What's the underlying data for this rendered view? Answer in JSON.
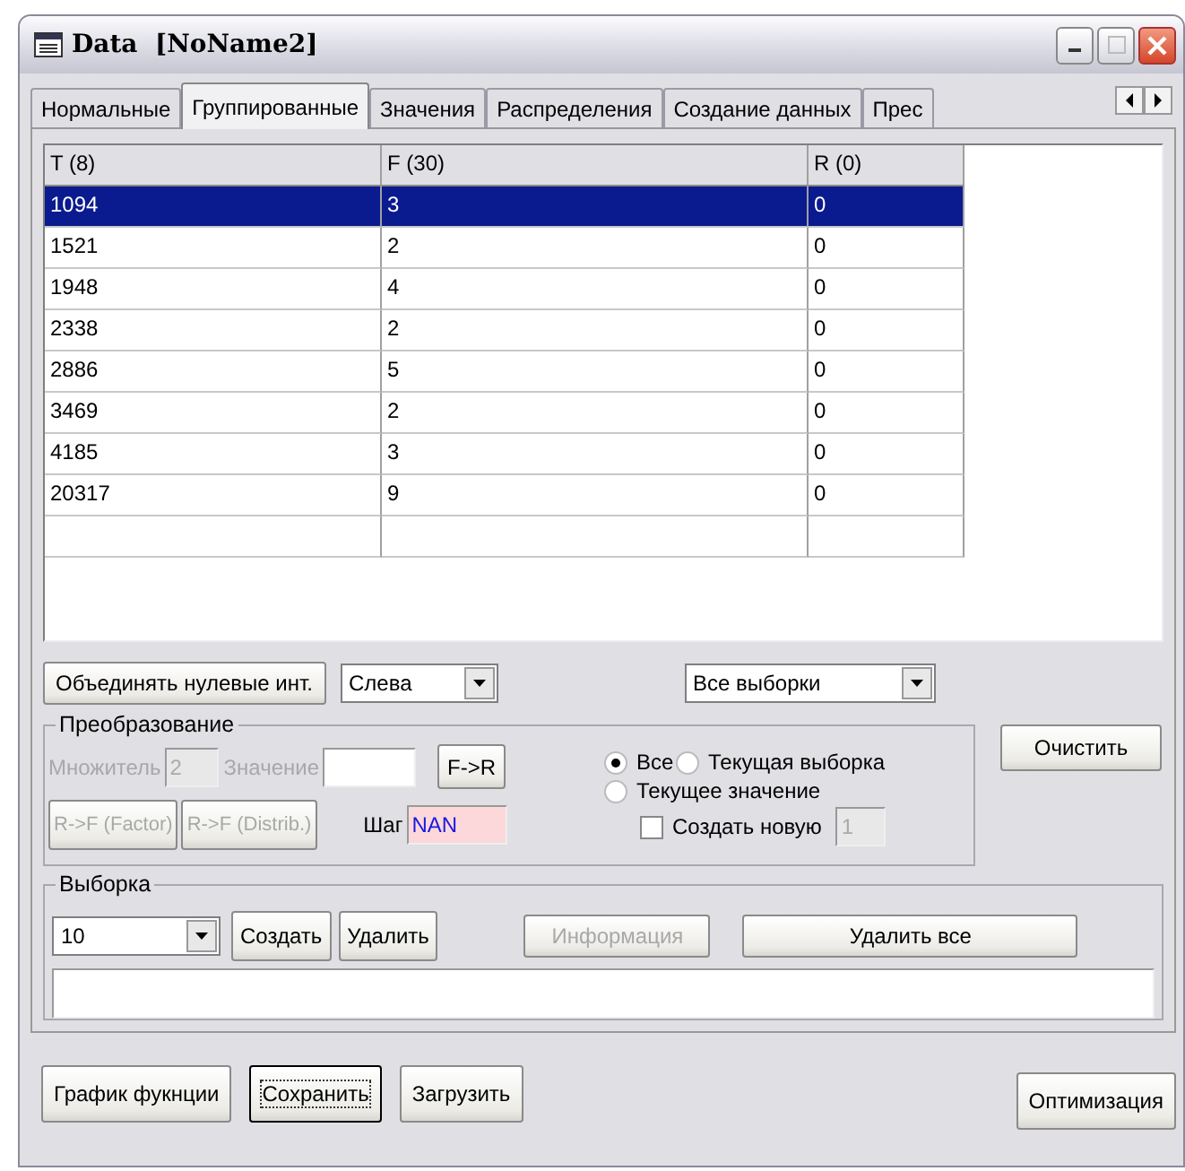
{
  "window": {
    "title": "Data  [NoName2]"
  },
  "tabs": [
    {
      "label": "Нормальные",
      "selected": false
    },
    {
      "label": "Группированные",
      "selected": true
    },
    {
      "label": "Значения",
      "selected": false
    },
    {
      "label": "Распределения",
      "selected": false
    },
    {
      "label": "Создание данных",
      "selected": false
    },
    {
      "label": "Прес",
      "selected": false
    }
  ],
  "table": {
    "columns": [
      "T (8)",
      "F (30)",
      "R (0)"
    ],
    "rows": [
      {
        "cells": [
          "1094",
          "3",
          "0"
        ],
        "selected": true
      },
      {
        "cells": [
          "1521",
          "2",
          "0"
        ],
        "selected": false
      },
      {
        "cells": [
          "1948",
          "4",
          "0"
        ],
        "selected": false
      },
      {
        "cells": [
          "2338",
          "2",
          "0"
        ],
        "selected": false
      },
      {
        "cells": [
          "2886",
          "5",
          "0"
        ],
        "selected": false
      },
      {
        "cells": [
          "3469",
          "2",
          "0"
        ],
        "selected": false
      },
      {
        "cells": [
          "4185",
          "3",
          "0"
        ],
        "selected": false
      },
      {
        "cells": [
          "20317",
          "9",
          "0"
        ],
        "selected": false
      }
    ]
  },
  "merge_button": "Объединять нулевые инт.",
  "side_select": {
    "value": "Слева"
  },
  "samples_select": {
    "value": "Все выборки"
  },
  "transform": {
    "title": "Преобразование",
    "multiplier": {
      "label": "Множитель",
      "value": "2",
      "disabled": true
    },
    "value_field": {
      "label": "Значение",
      "disabled": true
    },
    "f_to_r": {
      "label": "F->R"
    },
    "r_to_f_buttons": [
      {
        "label": "R->F (Factor)",
        "disabled": true
      },
      {
        "label": "R->F (Distrib.)",
        "disabled": true
      }
    ],
    "step": {
      "label": "Шаг",
      "value": "NAN"
    },
    "radios": [
      {
        "label": "Все",
        "selected": true
      },
      {
        "label": "Текущая выборка",
        "selected": false
      },
      {
        "label": "Текущее значение",
        "selected": false
      }
    ],
    "create_new": {
      "label": "Создать новую",
      "checked": false,
      "value": "1",
      "disabled": true
    }
  },
  "clear_button": "Очистить",
  "sample": {
    "title": "Выборка",
    "select": {
      "value": "10"
    },
    "buttons": [
      {
        "label": "Создать",
        "disabled": false
      },
      {
        "label": "Удалить",
        "disabled": false
      },
      {
        "label": "Информация",
        "disabled": true
      },
      {
        "label": "Удалить все",
        "disabled": false
      }
    ]
  },
  "bottom_buttons": [
    {
      "label": "График фукнции",
      "focused": false
    },
    {
      "label": "Сохранить",
      "focused": true
    },
    {
      "label": "Загрузить",
      "focused": false
    }
  ],
  "optimize_button": "Оптимизация"
}
